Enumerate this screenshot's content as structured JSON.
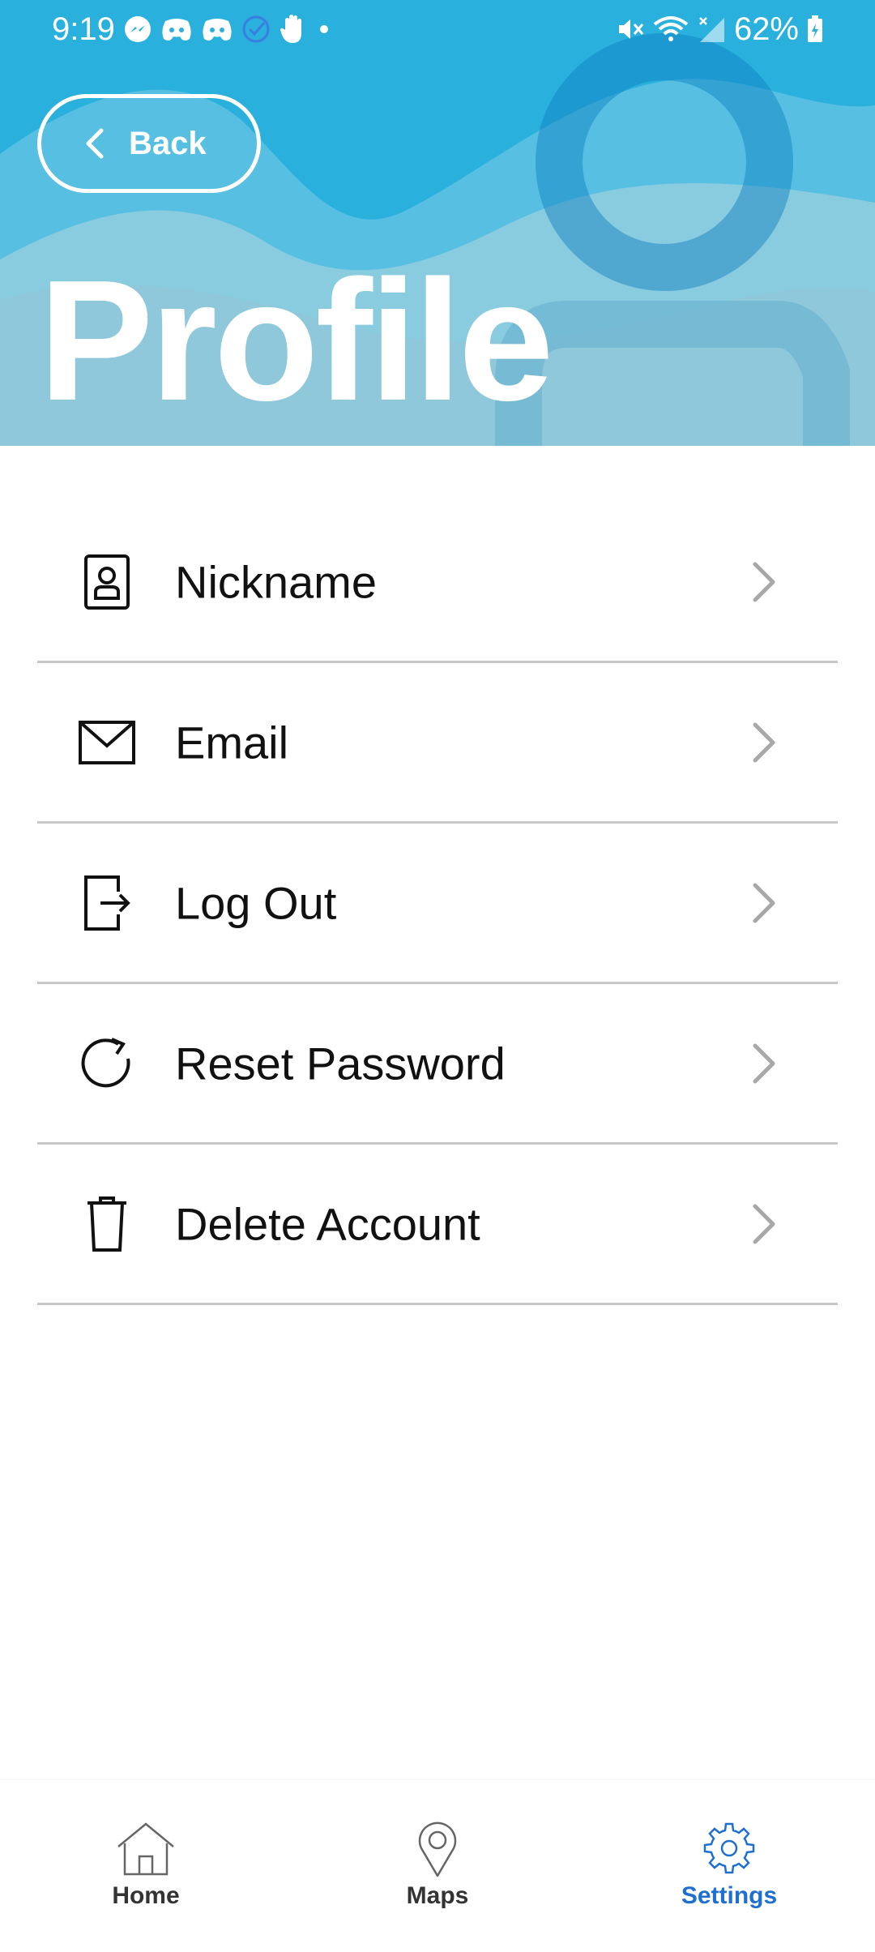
{
  "status_bar": {
    "time": "9:19",
    "battery": "62%",
    "left_icons": [
      "messenger-icon",
      "discord-icon",
      "discord-icon",
      "check-circle-icon",
      "hand-icon",
      "dot-icon"
    ],
    "right_icons": [
      "mute-icon",
      "wifi-icon",
      "signal-icon",
      "battery-icon"
    ]
  },
  "header": {
    "back_label": "Back",
    "title": "Profile",
    "background_color": "#29b0dd"
  },
  "menu": {
    "items": [
      {
        "label": "Nickname",
        "icon": "id-badge-icon"
      },
      {
        "label": "Email",
        "icon": "envelope-icon"
      },
      {
        "label": "Log Out",
        "icon": "logout-icon"
      },
      {
        "label": "Reset Password",
        "icon": "refresh-icon"
      },
      {
        "label": "Delete Account",
        "icon": "trash-icon"
      }
    ]
  },
  "bottom_nav": {
    "items": [
      {
        "label": "Home",
        "icon": "home-icon",
        "active": false
      },
      {
        "label": "Maps",
        "icon": "map-pin-icon",
        "active": false
      },
      {
        "label": "Settings",
        "icon": "gear-icon",
        "active": true
      }
    ],
    "active_color": "#1f6fd1"
  }
}
